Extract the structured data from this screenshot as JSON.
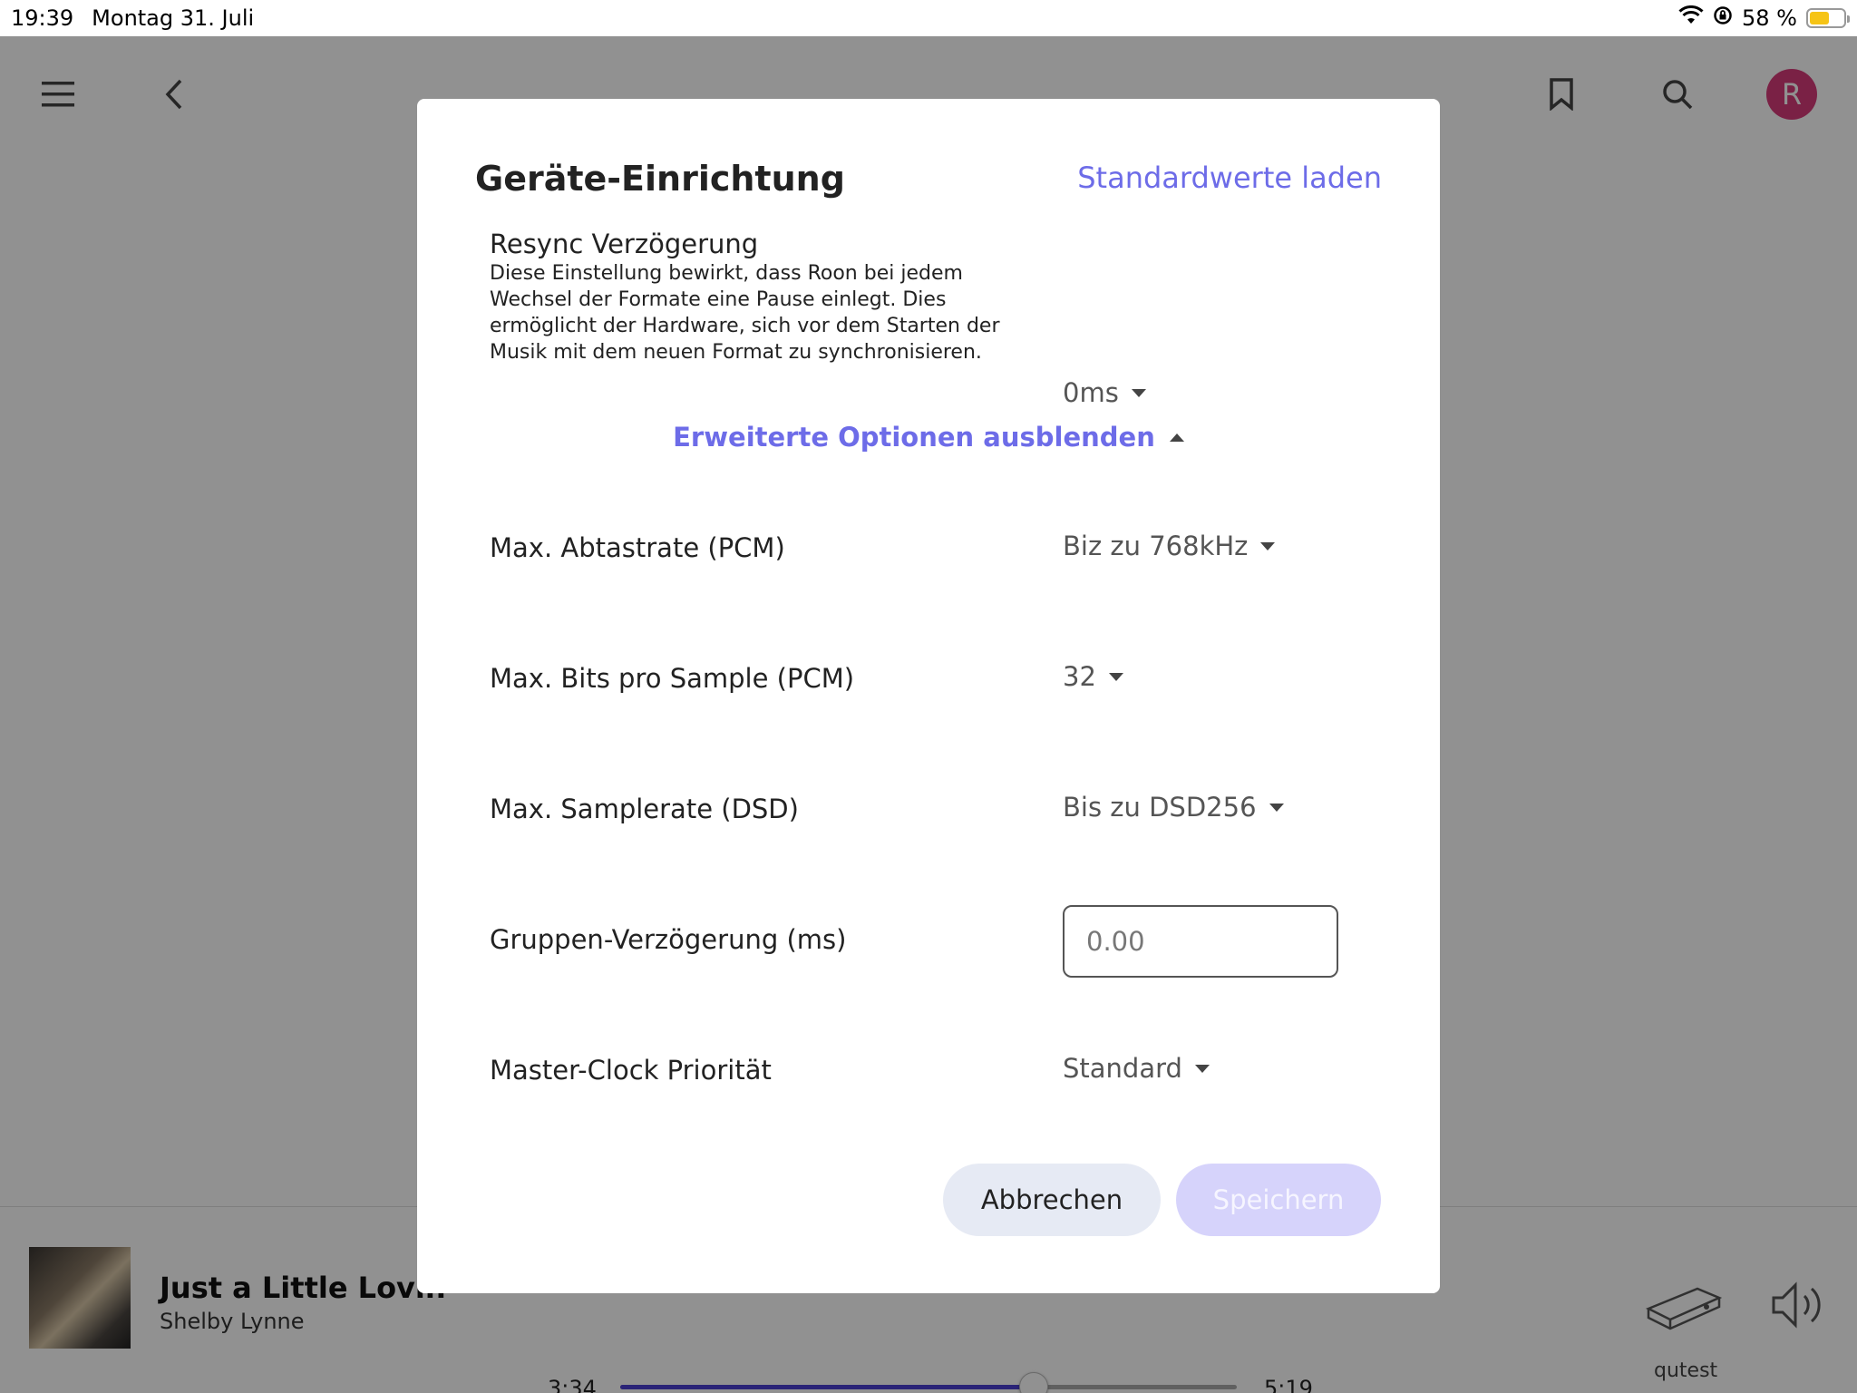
{
  "status_bar": {
    "time": "19:39",
    "date": "Montag 31. Juli",
    "battery_percent": "58 %",
    "battery_level": 0.58
  },
  "app": {
    "avatar_initial": "R",
    "now_playing": {
      "title": "Just a Little Lovin'",
      "artist": "Shelby Lynne",
      "elapsed": "3:34",
      "duration": "5:19",
      "progress": 0.67
    },
    "zone": {
      "device_name": "qutest"
    }
  },
  "modal": {
    "title": "Geräte-Einrichtung",
    "load_defaults": "Standardwerte laden",
    "resync": {
      "label": "Resync Verzögerung",
      "description": "Diese Einstellung bewirkt, dass Roon bei jedem Wechsel der Formate eine Pause einlegt. Dies ermöglicht der Hardware, sich vor dem Starten der Musik mit dem neuen Format zu synchronisieren.",
      "value": "0ms"
    },
    "advanced_toggle": "Erweiterte Optionen ausblenden",
    "settings": {
      "max_sample_rate_pcm": {
        "label": "Max. Abtastrate (PCM)",
        "value": "Biz zu 768kHz"
      },
      "max_bits_pcm": {
        "label": "Max. Bits pro Sample (PCM)",
        "value": "32"
      },
      "max_sample_rate_dsd": {
        "label": "Max. Samplerate (DSD)",
        "value": "Bis zu DSD256"
      },
      "group_delay": {
        "label": "Gruppen-Verzögerung (ms)",
        "placeholder": "0.00"
      },
      "master_clock": {
        "label": "Master-Clock Priorität",
        "value": "Standard"
      }
    },
    "buttons": {
      "cancel": "Abbrechen",
      "save": "Speichern"
    }
  },
  "colors": {
    "accent": "#6d6ce8",
    "avatar": "#d63a79",
    "progress": "#4a3fd2",
    "battery": "#f6c416"
  }
}
